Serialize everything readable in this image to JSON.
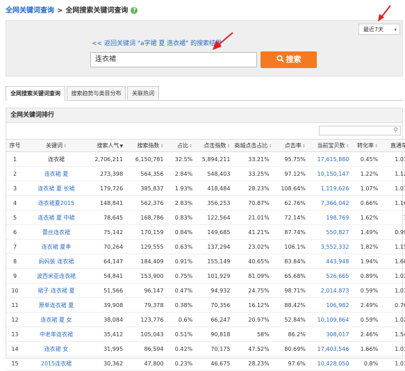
{
  "breadcrumb": {
    "root": "全网关键词查询",
    "separator": ">",
    "current": "全网搜索关键词查询",
    "help": "?"
  },
  "range_select": {
    "value": "最近7天",
    "caret": "▾"
  },
  "search": {
    "back_link": "<< 返回关键词 \"a字裙 夏 连衣裙\" 的搜索结果",
    "query": "连衣裙",
    "button_label": "搜索",
    "button_icon": "search-icon"
  },
  "tabs": [
    {
      "label": "全网搜索关键词查询",
      "active": true
    },
    {
      "label": "搜索趋势与类目分布",
      "active": false
    },
    {
      "label": "关联热词",
      "active": false
    }
  ],
  "ranking": {
    "title": "全网关键词排行",
    "columns": [
      "序号",
      "关键词",
      "搜索人气",
      "搜索指数",
      "占比",
      "点击指数",
      "商城点击占比",
      "点击率",
      "当前宝贝数",
      "转化率",
      "直通车"
    ],
    "rows": [
      [
        "1",
        "连衣裙",
        "2,706,211",
        "6,150,781",
        "32.5%",
        "5,894,211",
        "33.21%",
        "95.75%",
        "17,615,880",
        "0.45%",
        "1.01"
      ],
      [
        "2",
        "连衣裙 夏",
        "273,398",
        "564,356",
        "2.84%",
        "548,403",
        "33.25%",
        "97.12%",
        "10,150,147",
        "1.22%",
        "1.12"
      ],
      [
        "3",
        "连衣裙 夏 长裙",
        "179,726",
        "385,837",
        "1.93%",
        "418,484",
        "28.23%",
        "108.64%",
        "1,119,626",
        "1.07%",
        "1.07"
      ],
      [
        "4",
        "连衣裙夏2015",
        "148,841",
        "562,376",
        "2.83%",
        "356,253",
        "70.87%",
        "62.76%",
        "7,366,042",
        "0.66%",
        "1.16"
      ],
      [
        "5",
        "连衣裙 夏 中裙",
        "78,645",
        "168,786",
        "0.83%",
        "122,564",
        "21.01%",
        "72.14%",
        "198,769",
        "1.62%",
        "1"
      ],
      [
        "6",
        "蕾丝连衣裙",
        "75,142",
        "170,159",
        "0.84%",
        "149,685",
        "41.21%",
        "87.74%",
        "550,827",
        "1.49%",
        "0.99"
      ],
      [
        "7",
        "连衣裙 夏季",
        "70,264",
        "129,555",
        "0.63%",
        "137,294",
        "23.02%",
        "106.1%",
        "3,552,332",
        "1.82%",
        "1.15"
      ],
      [
        "8",
        "妈妈装 连衣裙",
        "64,147",
        "184,409",
        "0.91%",
        "155,149",
        "40.65%",
        "83.84%",
        "443,948",
        "1.94%",
        "1.68"
      ],
      [
        "9",
        "波西米亚连衣裙",
        "54,841",
        "153,900",
        "0.75%",
        "101,929",
        "81.09%",
        "65.68%",
        "526,665",
        "0.89%",
        "1.02"
      ],
      [
        "10",
        "裙子 连衣裙 夏",
        "51,566",
        "96,147",
        "0.47%",
        "94,932",
        "24.75%",
        "98.71%",
        "2,014,873",
        "0.59%",
        "1.01"
      ],
      [
        "11",
        "原单连衣裙 夏",
        "39,908",
        "79,378",
        "0.38%",
        "70,356",
        "16.12%",
        "88.42%",
        "106,982",
        "2.49%",
        "0.76"
      ],
      [
        "12",
        "连衣裙 夏 女",
        "38,084",
        "123,776",
        "0.6%",
        "66,247",
        "20.97%",
        "52.84%",
        "10,109,864",
        "0.59%",
        "1.02"
      ],
      [
        "13",
        "中老年连衣裙",
        "35,412",
        "105,043",
        "0.51%",
        "90,818",
        "58%",
        "86.2%",
        "308,017",
        "2.46%",
        "1.54"
      ],
      [
        "14",
        "连衣裙 女",
        "31,995",
        "86,594",
        "0.42%",
        "70,175",
        "47.52%",
        "80.69%",
        "17,403,546",
        "1.66%",
        "1.01"
      ],
      [
        "15",
        "2015连衣裙",
        "30,362",
        "47,800",
        "0.23%",
        "46,675",
        "28.23%",
        "97.6%",
        "10,428,050",
        "0.8%",
        "1.01"
      ]
    ]
  },
  "colors": {
    "link": "#2a6cc7",
    "button": "#f47920",
    "arrow": "#e02020",
    "help": "#5cb85c"
  }
}
